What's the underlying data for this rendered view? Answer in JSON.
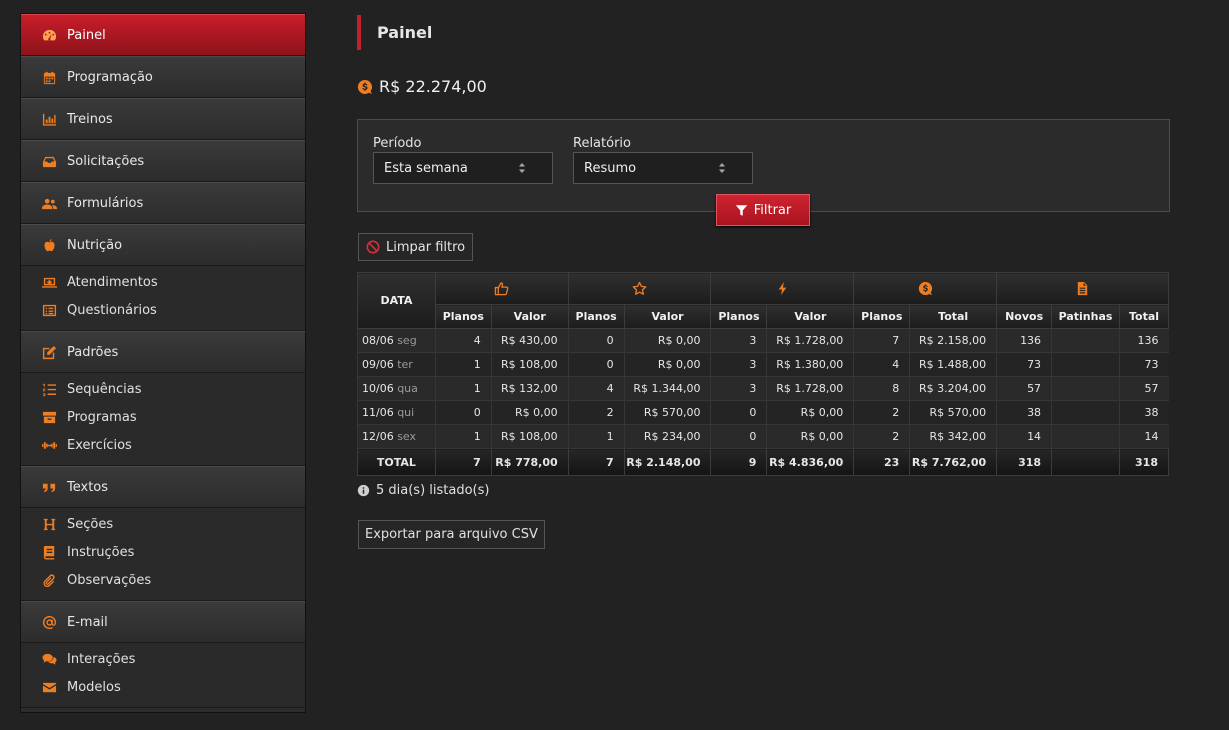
{
  "sidebar": {
    "groups": [
      {
        "label": "Painel",
        "icon": "dashboard-icon",
        "active": true,
        "items": []
      },
      {
        "label": "Programação",
        "icon": "calendar-icon",
        "items": []
      },
      {
        "label": "Treinos",
        "icon": "bar-chart-icon",
        "items": []
      },
      {
        "label": "Solicitações",
        "icon": "inbox-icon",
        "items": []
      },
      {
        "label": "Formulários",
        "icon": "users-icon",
        "items": []
      },
      {
        "label": "Nutrição",
        "icon": "apple-icon",
        "items": [
          {
            "label": "Atendimentos",
            "icon": "laptop-medical-icon"
          },
          {
            "label": "Questionários",
            "icon": "list-alt-icon"
          }
        ]
      },
      {
        "label": "Padrões",
        "icon": "edit-icon",
        "items": [
          {
            "label": "Sequências",
            "icon": "list-ol-icon"
          },
          {
            "label": "Programas",
            "icon": "archive-icon"
          },
          {
            "label": "Exercícios",
            "icon": "dumbbell-icon"
          }
        ]
      },
      {
        "label": "Textos",
        "icon": "quote-icon",
        "items": [
          {
            "label": "Seções",
            "icon": "heading-icon"
          },
          {
            "label": "Instruções",
            "icon": "book-icon"
          },
          {
            "label": "Observações",
            "icon": "paperclip-icon"
          }
        ]
      },
      {
        "label": "E-mail",
        "icon": "at-icon",
        "items": [
          {
            "label": "Interações",
            "icon": "comments-icon"
          },
          {
            "label": "Modelos",
            "icon": "envelope-icon"
          }
        ]
      }
    ]
  },
  "header": {
    "title": "Painel"
  },
  "balance": {
    "value": "R$ 22.274,00",
    "icon": "coin-icon"
  },
  "filters": {
    "period_label": "Período",
    "period_value": "Esta semana",
    "report_label": "Relatório",
    "report_value": "Resumo",
    "filter_button": "Filtrar",
    "clear_button": "Limpar filtro"
  },
  "table": {
    "date_header": "DATA",
    "groups": [
      {
        "icon": "thumbs-up-icon",
        "columns": [
          "Planos",
          "Valor"
        ]
      },
      {
        "icon": "star-icon",
        "columns": [
          "Planos",
          "Valor"
        ]
      },
      {
        "icon": "bolt-icon",
        "columns": [
          "Planos",
          "Valor"
        ]
      },
      {
        "icon": "coin-icon",
        "columns": [
          "Planos",
          "Total"
        ]
      },
      {
        "icon": "file-icon",
        "columns": [
          "Novos",
          "Patinhas",
          "Total"
        ]
      }
    ],
    "rows": [
      {
        "date": "08/06",
        "weekday": "seg",
        "cells": [
          "4",
          "R$ 430,00",
          "0",
          "R$ 0,00",
          "3",
          "R$ 1.728,00",
          "7",
          "R$ 2.158,00",
          "136",
          "",
          "136"
        ]
      },
      {
        "date": "09/06",
        "weekday": "ter",
        "cells": [
          "1",
          "R$ 108,00",
          "0",
          "R$ 0,00",
          "3",
          "R$ 1.380,00",
          "4",
          "R$ 1.488,00",
          "73",
          "",
          "73"
        ]
      },
      {
        "date": "10/06",
        "weekday": "qua",
        "cells": [
          "1",
          "R$ 132,00",
          "4",
          "R$ 1.344,00",
          "3",
          "R$ 1.728,00",
          "8",
          "R$ 3.204,00",
          "57",
          "",
          "57"
        ]
      },
      {
        "date": "11/06",
        "weekday": "qui",
        "cells": [
          "0",
          "R$ 0,00",
          "2",
          "R$ 570,00",
          "0",
          "R$ 0,00",
          "2",
          "R$ 570,00",
          "38",
          "",
          "38"
        ]
      },
      {
        "date": "12/06",
        "weekday": "sex",
        "cells": [
          "1",
          "R$ 108,00",
          "1",
          "R$ 234,00",
          "0",
          "R$ 0,00",
          "2",
          "R$ 342,00",
          "14",
          "",
          "14"
        ]
      }
    ],
    "total": {
      "label": "TOTAL",
      "cells": [
        "7",
        "R$ 778,00",
        "7",
        "R$ 2.148,00",
        "9",
        "R$ 4.836,00",
        "23",
        "R$ 7.762,00",
        "318",
        "",
        "318"
      ]
    }
  },
  "footer": {
    "count_text": "5 dia(s) listado(s)",
    "export_button": "Exportar para arquivo CSV"
  },
  "colors": {
    "accent": "#c2202c",
    "icon": "#ef7d22",
    "background": "#222222"
  }
}
